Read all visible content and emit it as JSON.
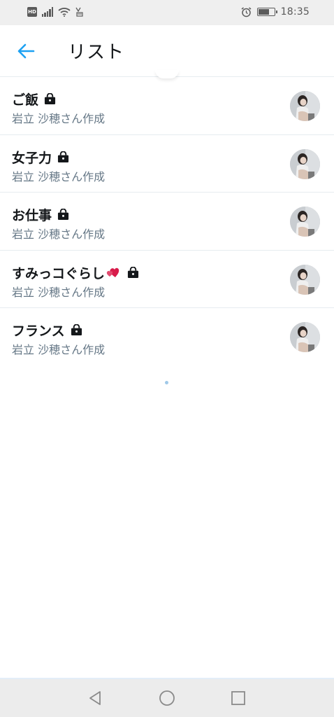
{
  "status_bar": {
    "time": "18:35",
    "left_icons": [
      "hd-icon",
      "signal-icon",
      "wifi-icon",
      "data-saver-icon"
    ],
    "hd_label": "HD",
    "right_icons": [
      "alarm-icon",
      "battery-charging-icon"
    ]
  },
  "header": {
    "title": "リスト",
    "back_icon": "arrow-left-icon",
    "accent_color": "#1da1f2"
  },
  "lists": [
    {
      "name": "ご飯",
      "creator": "岩立 沙穂さん作成",
      "private": true,
      "emoji": ""
    },
    {
      "name": "女子力",
      "creator": "岩立 沙穂さん作成",
      "private": true,
      "emoji": ""
    },
    {
      "name": "お仕事",
      "creator": "岩立 沙穂さん作成",
      "private": true,
      "emoji": ""
    },
    {
      "name": "すみっコぐらし",
      "creator": "岩立 沙穂さん作成",
      "private": true,
      "emoji": "heart-icon"
    },
    {
      "name": "フランス",
      "creator": "岩立 沙穂さん作成",
      "private": true,
      "emoji": ""
    }
  ],
  "nav_bar": {
    "icons": [
      "back-triangle-icon",
      "home-circle-icon",
      "recents-square-icon"
    ]
  },
  "colors": {
    "text_primary": "#14171a",
    "text_secondary": "#657786",
    "divider": "#e6ecf0",
    "heart": "#d81b4a"
  }
}
